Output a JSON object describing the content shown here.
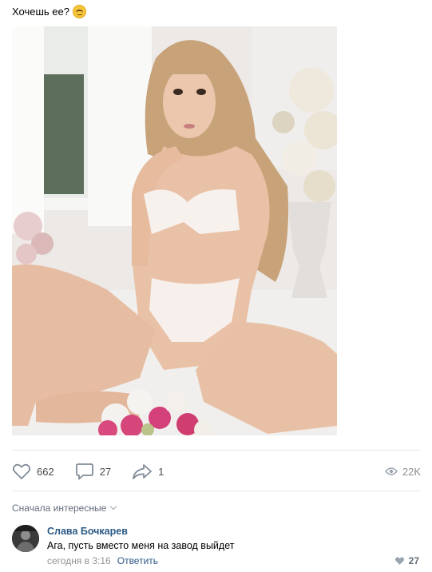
{
  "post": {
    "text": "Хочешь ее?",
    "emoji_icon": "flushed-face-emoji"
  },
  "actions": {
    "likes": "662",
    "comments": "27",
    "shares": "1",
    "views": "22K"
  },
  "comments_section": {
    "sort_label": "Сначала интересные",
    "items": [
      {
        "author": "Слава Бочкарев",
        "text": "Ага, пусть вместо меня на завод выйдет",
        "time": "сегодня в 3:16",
        "reply_label": "Ответить",
        "likes": "27"
      }
    ]
  },
  "colors": {
    "link": "#2a5885",
    "icon": "#818c99",
    "divider": "#e7e8ec"
  }
}
